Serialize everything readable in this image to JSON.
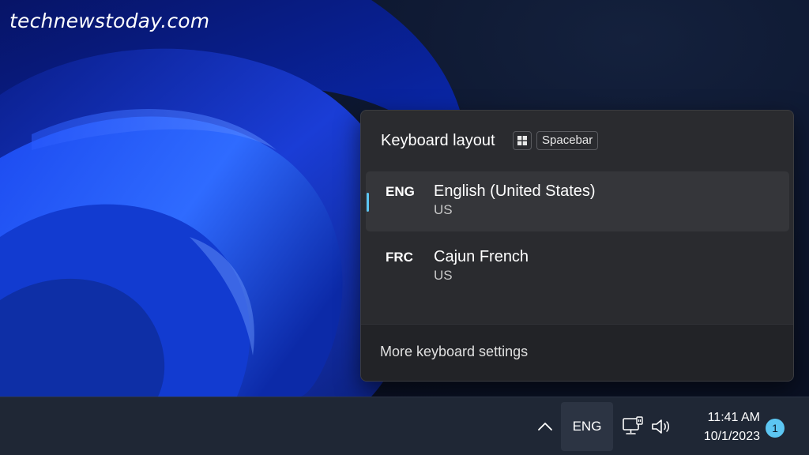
{
  "watermark": "technewstoday.com",
  "flyout": {
    "title": "Keyboard layout",
    "shortcut": {
      "win_key_icon": "windows-logo-icon",
      "key_label": "Spacebar"
    },
    "layouts": [
      {
        "code": "ENG",
        "name": "English (United States)",
        "keyboard": "US",
        "selected": true
      },
      {
        "code": "FRC",
        "name": "Cajun French",
        "keyboard": "US",
        "selected": false
      }
    ],
    "footer_link": "More keyboard settings"
  },
  "taskbar": {
    "overflow_icon": "chevron-up-icon",
    "language": "ENG",
    "network_icon": "network-icon",
    "volume_icon": "volume-icon",
    "time": "11:41 AM",
    "date": "10/1/2023",
    "notification_count": "1"
  },
  "colors": {
    "accent": "#5cc6f2",
    "flyout_bg": "#2a2b2f",
    "taskbar_bg": "#1f2735"
  }
}
